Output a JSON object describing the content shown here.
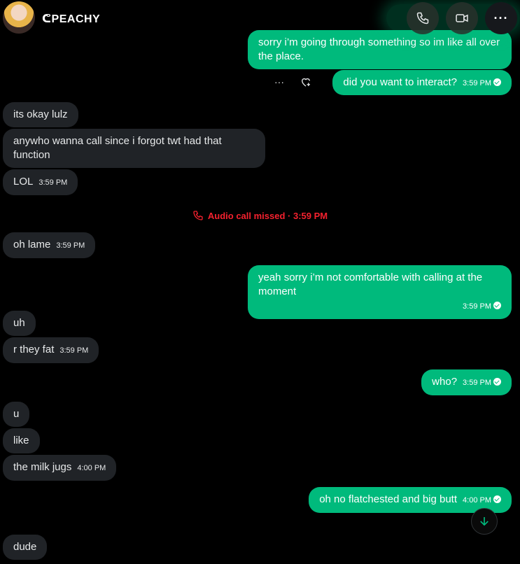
{
  "header": {
    "title": "ᕦPEACHY",
    "avatar_icon": "profile-avatar",
    "call_icon": "phone-icon",
    "video_icon": "video-camera-icon",
    "more_label": "···"
  },
  "messages": [
    {
      "from": "me",
      "text": "sorry i’m going through something so im like all over the place.",
      "time": ""
    },
    {
      "from": "me",
      "text": "did you want to interact?",
      "time": "3:59 PM"
    },
    {
      "from": "them",
      "text": "its okay lulz",
      "time": ""
    },
    {
      "from": "them",
      "text": "anywho wanna call since i forgot twt had that function",
      "time": ""
    },
    {
      "from": "them",
      "text": "LOL",
      "time": "3:59 PM"
    },
    {
      "from": "them",
      "text": "oh lame",
      "time": "3:59 PM"
    },
    {
      "from": "me",
      "text": "yeah sorry i’m not comfortable with calling at the moment",
      "time": "3:59 PM"
    },
    {
      "from": "them",
      "text": "uh",
      "time": ""
    },
    {
      "from": "them",
      "text": "r they fat",
      "time": "3:59 PM"
    },
    {
      "from": "me",
      "text": "who?",
      "time": "3:59 PM"
    },
    {
      "from": "them",
      "text": "u",
      "time": ""
    },
    {
      "from": "them",
      "text": "like",
      "time": ""
    },
    {
      "from": "them",
      "text": "the milk jugs",
      "time": "4:00 PM"
    },
    {
      "from": "me",
      "text": "oh no flatchested and big butt",
      "time": "4:00 PM"
    },
    {
      "from": "them",
      "text": "dude",
      "time": ""
    }
  ],
  "missed_call": "Audio call missed · 3:59 PM",
  "actions": {
    "more": "···"
  },
  "colors": {
    "accent": "#00ba7c",
    "incoming": "#202327",
    "missed": "#f4212e"
  }
}
